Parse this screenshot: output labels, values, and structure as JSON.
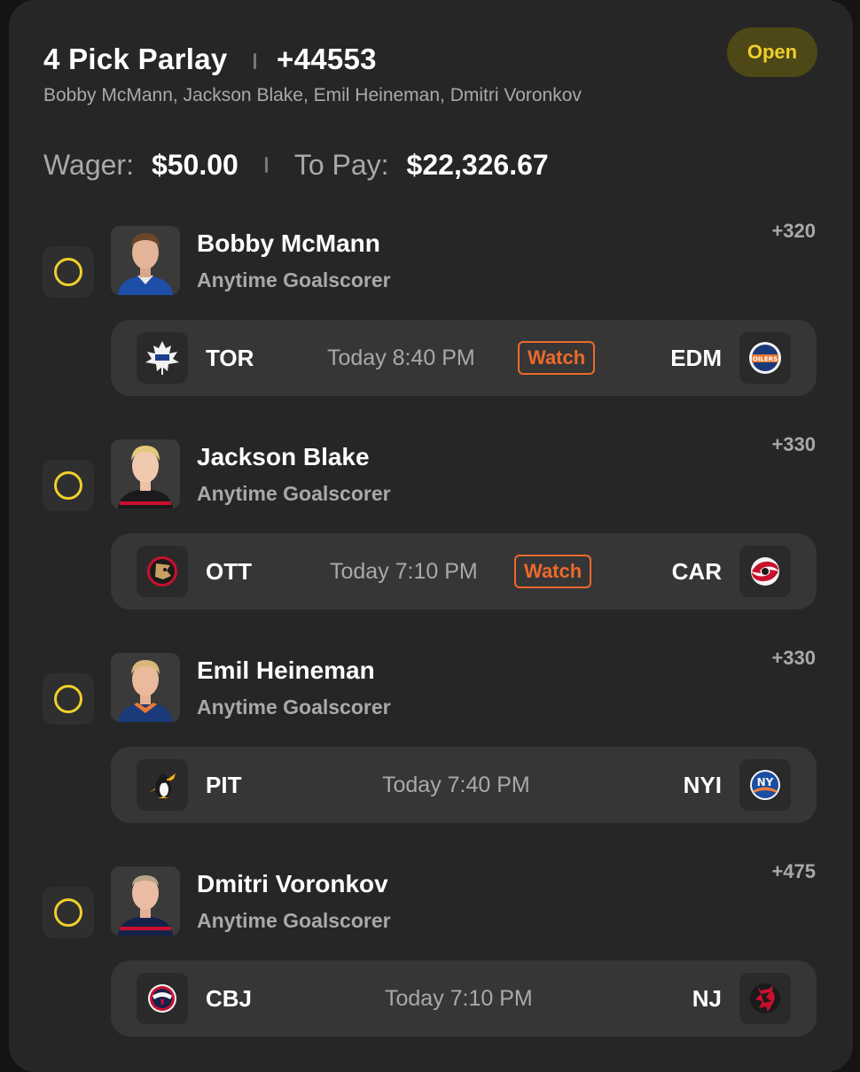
{
  "header": {
    "title": "4 Pick Parlay",
    "odds": "+44553",
    "legs_summary": "Bobby McMann, Jackson Blake, Emil Heineman, Dmitri Voronkov",
    "status": "Open"
  },
  "wager": {
    "wager_label": "Wager:",
    "wager_value": "$50.00",
    "to_pay_label": "To Pay:",
    "to_pay_value": "$22,326.67"
  },
  "legs": [
    {
      "player": "Bobby McMann",
      "market": "Anytime Goalscorer",
      "odds": "+320",
      "away": "TOR",
      "home": "EDM",
      "time": "Today 8:40 PM",
      "watch": "Watch",
      "away_logo": "maple-leafs-logo-icon",
      "home_logo": "oilers-logo-icon"
    },
    {
      "player": "Jackson Blake",
      "market": "Anytime Goalscorer",
      "odds": "+330",
      "away": "OTT",
      "home": "CAR",
      "time": "Today 7:10 PM",
      "watch": "Watch",
      "away_logo": "senators-logo-icon",
      "home_logo": "hurricanes-logo-icon"
    },
    {
      "player": "Emil Heineman",
      "market": "Anytime Goalscorer",
      "odds": "+330",
      "away": "PIT",
      "home": "NYI",
      "time": "Today 7:40 PM",
      "away_logo": "penguins-logo-icon",
      "home_logo": "islanders-logo-icon"
    },
    {
      "player": "Dmitri Voronkov",
      "market": "Anytime Goalscorer",
      "odds": "+475",
      "away": "CBJ",
      "home": "NJ",
      "time": "Today 7:10 PM",
      "away_logo": "blue-jackets-logo-icon",
      "home_logo": "devils-logo-icon"
    }
  ],
  "colors": {
    "accent_yellow": "#f1cf2c",
    "watch_orange": "#ec6a2c",
    "card_bg": "#262626"
  }
}
